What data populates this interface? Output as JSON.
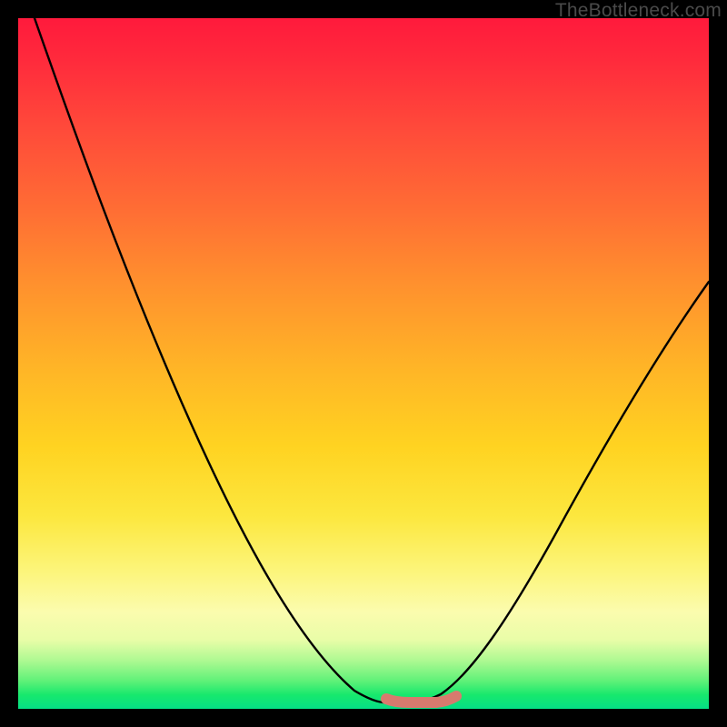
{
  "watermark": "TheBottleneck.com",
  "colors": {
    "background": "#000000",
    "curve": "#000000",
    "flat_segment": "#d87a6e",
    "gradient_stops": [
      "#ff1a3c",
      "#ff8f2e",
      "#ffd321",
      "#fbfcae",
      "#05df86"
    ]
  },
  "chart_data": {
    "type": "line",
    "title": "",
    "xlabel": "",
    "ylabel": "",
    "xlim": [
      0,
      100
    ],
    "ylim": [
      0,
      100
    ],
    "series": [
      {
        "name": "bottleneck-curve",
        "x": [
          0,
          5,
          10,
          15,
          20,
          25,
          30,
          35,
          40,
          45,
          50,
          53,
          57,
          60,
          63,
          67,
          72,
          78,
          85,
          92,
          100
        ],
        "values": [
          100,
          91,
          82,
          73,
          63,
          53,
          43,
          33,
          23,
          14,
          6,
          2,
          1,
          1,
          2,
          6,
          14,
          25,
          38,
          50,
          62
        ]
      }
    ],
    "flat_segment": {
      "x_start": 53,
      "x_end": 63,
      "y": 1
    }
  }
}
